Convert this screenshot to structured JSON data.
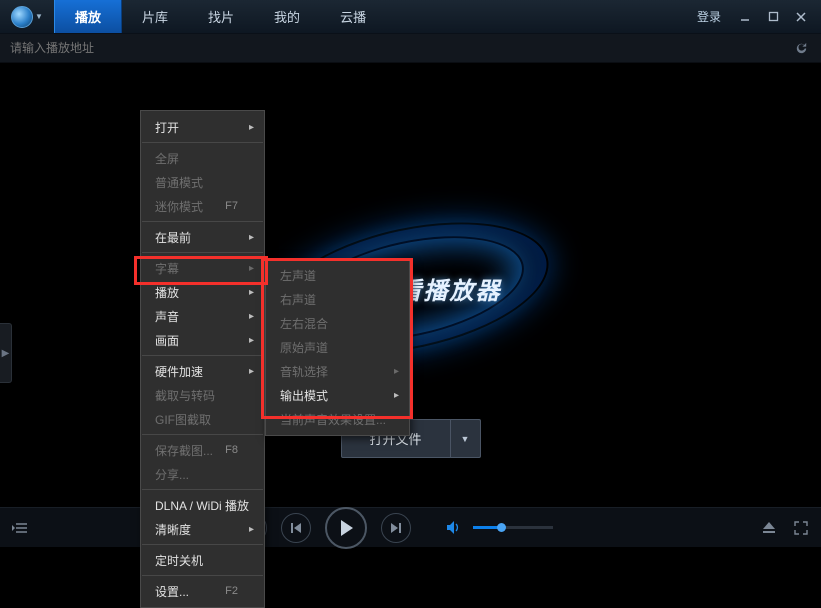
{
  "topnav": {
    "items": [
      {
        "label": "播放",
        "active": true
      },
      {
        "label": "片库",
        "active": false
      },
      {
        "label": "找片",
        "active": false
      },
      {
        "label": "我的",
        "active": false
      },
      {
        "label": "云播",
        "active": false
      }
    ],
    "login": "登录"
  },
  "addr": {
    "placeholder": "请输入播放地址"
  },
  "brand": {
    "text": "迅雷看看播放器"
  },
  "openfile": {
    "label": "打开文件"
  },
  "ctx1": {
    "groups": [
      [
        {
          "label": "打开",
          "sub": true
        }
      ],
      [
        {
          "label": "全屏",
          "disabled": true
        },
        {
          "label": "普通模式",
          "disabled": true
        },
        {
          "label": "迷你模式",
          "disabled": true,
          "shortcut": "F7"
        }
      ],
      [
        {
          "label": "在最前",
          "sub": true
        }
      ],
      [
        {
          "label": "字幕",
          "disabled": true,
          "sub": true
        },
        {
          "label": "播放",
          "sub": true
        },
        {
          "label": "声音",
          "sub": true,
          "highlight": true
        },
        {
          "label": "画面",
          "sub": true
        }
      ],
      [
        {
          "label": "硬件加速",
          "sub": true
        },
        {
          "label": "截取与转码",
          "disabled": true
        },
        {
          "label": "GIF图截取",
          "disabled": true
        }
      ],
      [
        {
          "label": "保存截图...",
          "disabled": true,
          "shortcut": "F8"
        },
        {
          "label": "分享...",
          "disabled": true
        }
      ],
      [
        {
          "label": "DLNA / WiDi 播放"
        },
        {
          "label": "清晰度",
          "sub": true
        }
      ],
      [
        {
          "label": "定时关机"
        }
      ],
      [
        {
          "label": "设置...",
          "shortcut": "F2"
        }
      ]
    ]
  },
  "ctx2": {
    "items": [
      {
        "label": "左声道",
        "disabled": true
      },
      {
        "label": "右声道",
        "disabled": true
      },
      {
        "label": "左右混合",
        "disabled": true
      },
      {
        "label": "原始声道",
        "disabled": true
      },
      {
        "label": "音轨选择",
        "disabled": true,
        "sub": true
      },
      {
        "label": "输出模式",
        "sub": true
      },
      {
        "label": "当前声音效果设置...",
        "disabled": true
      }
    ]
  },
  "volume": {
    "percent": 35
  }
}
